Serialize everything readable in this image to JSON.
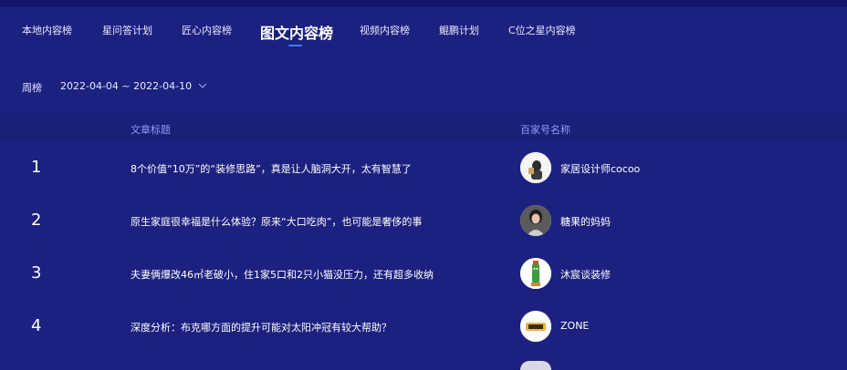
{
  "tabs": [
    {
      "label": "本地内容榜"
    },
    {
      "label": "星问答计划"
    },
    {
      "label": "匠心内容榜"
    },
    {
      "label": "图文内容榜"
    },
    {
      "label": "视频内容榜"
    },
    {
      "label": "鲲鹏计划"
    },
    {
      "label": "C位之星内容榜"
    }
  ],
  "filter": {
    "period_label": "周榜",
    "date_range": "2022-04-04 ~ 2022-04-10"
  },
  "table": {
    "columns": {
      "title": "文章标题",
      "account": "百家号名称"
    },
    "rows": [
      {
        "rank": "1",
        "title": "8个价值“10万”的“装修思路”，真是让人脑洞大开，太有智慧了",
        "account": "家居设计师cocoo"
      },
      {
        "rank": "2",
        "title": "原生家庭很幸福是什么体验？原来“大口吃肉”，也可能是奢侈的事",
        "account": "糖果的妈妈"
      },
      {
        "rank": "3",
        "title": "夫妻俩爆改46㎡老破小，住1家5口和2只小猫没压力，还有超多收纳",
        "account": "沐宸谈装修"
      },
      {
        "rank": "4",
        "title": "深度分析：布克哪方面的提升可能对太阳冲冠有较大帮助？",
        "account": "ZONE"
      }
    ]
  },
  "colors": {
    "background": "#1c2180",
    "accent": "#3f7cff",
    "header_text": "#8f9dff"
  }
}
